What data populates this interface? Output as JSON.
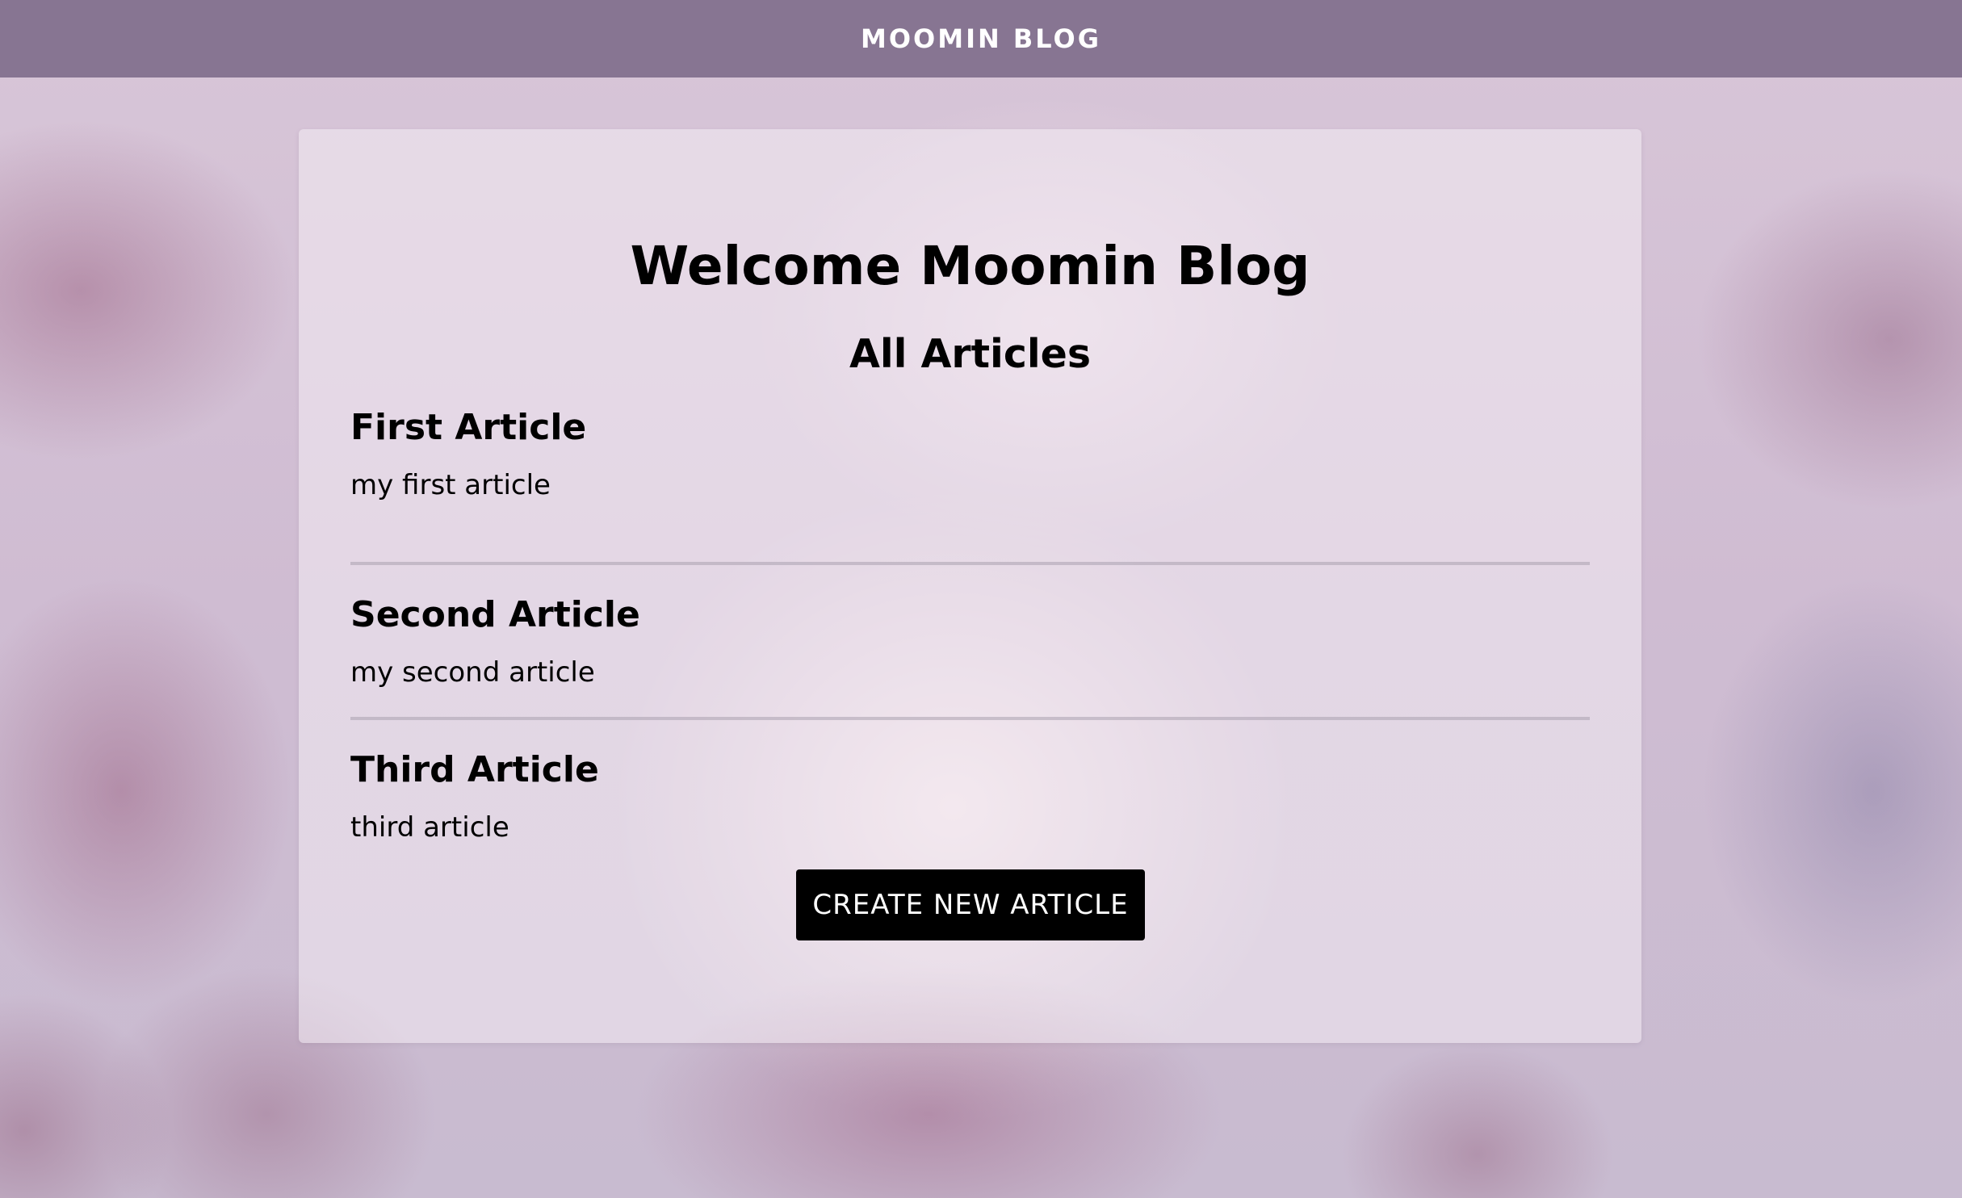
{
  "navbar": {
    "brand": "MOOMIN BLOG"
  },
  "main": {
    "welcome_title": "Welcome Moomin Blog",
    "section_title": "All Articles",
    "articles": [
      {
        "title": "First Article",
        "description": "my first article"
      },
      {
        "title": "Second Article",
        "description": "my second article"
      },
      {
        "title": "Third Article",
        "description": "third article"
      }
    ],
    "create_button_label": "CREATE NEW ARTICLE"
  },
  "colors": {
    "navbar_background": "#806e8c",
    "button_background": "#000000",
    "button_text": "#ffffff",
    "text": "#000000"
  }
}
